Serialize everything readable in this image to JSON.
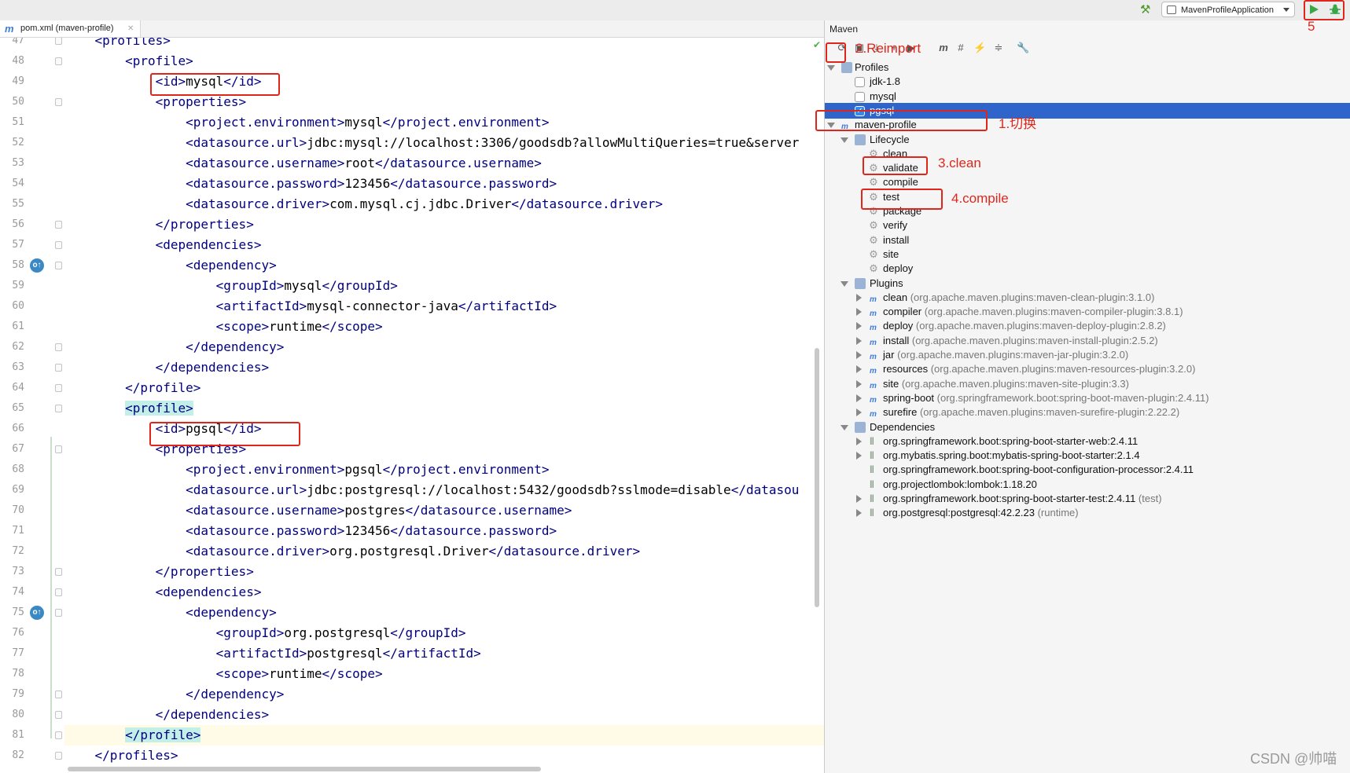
{
  "topbar": {
    "run_config": "MavenProfileApplication"
  },
  "editor": {
    "tab_label": "pom.xml (maven-profile)",
    "lines": [
      {
        "n": "47",
        "indent": "    ",
        "parts": [
          [
            "tg",
            "<profiles>"
          ]
        ]
      },
      {
        "n": "48",
        "indent": "        ",
        "parts": [
          [
            "tg",
            "<profile>"
          ]
        ]
      },
      {
        "n": "49",
        "indent": "            ",
        "parts": [
          [
            "tg",
            "<id>"
          ],
          [
            "tx",
            "mysql"
          ],
          [
            "tg",
            "</id>"
          ]
        ]
      },
      {
        "n": "50",
        "indent": "            ",
        "parts": [
          [
            "tg",
            "<properties>"
          ]
        ]
      },
      {
        "n": "51",
        "indent": "                ",
        "parts": [
          [
            "tg",
            "<project.environment>"
          ],
          [
            "tx",
            "mysql"
          ],
          [
            "tg",
            "</project.environment>"
          ]
        ]
      },
      {
        "n": "52",
        "indent": "                ",
        "parts": [
          [
            "tg",
            "<datasource.url>"
          ],
          [
            "tx",
            "jdbc:mysql://localhost:3306/goodsdb?allowMultiQueries=true&server"
          ]
        ]
      },
      {
        "n": "53",
        "indent": "                ",
        "parts": [
          [
            "tg",
            "<datasource.username>"
          ],
          [
            "tx",
            "root"
          ],
          [
            "tg",
            "</datasource.username>"
          ]
        ]
      },
      {
        "n": "54",
        "indent": "                ",
        "parts": [
          [
            "tg",
            "<datasource.password>"
          ],
          [
            "tx",
            "123456"
          ],
          [
            "tg",
            "</datasource.password>"
          ]
        ]
      },
      {
        "n": "55",
        "indent": "                ",
        "parts": [
          [
            "tg",
            "<datasource.driver>"
          ],
          [
            "tx",
            "com.mysql.cj.jdbc.Driver"
          ],
          [
            "tg",
            "</datasource.driver>"
          ]
        ]
      },
      {
        "n": "56",
        "indent": "            ",
        "parts": [
          [
            "tg",
            "</properties>"
          ]
        ]
      },
      {
        "n": "57",
        "indent": "            ",
        "parts": [
          [
            "tg",
            "<dependencies>"
          ]
        ]
      },
      {
        "n": "58",
        "indent": "                ",
        "parts": [
          [
            "tg",
            "<dependency>"
          ]
        ]
      },
      {
        "n": "59",
        "indent": "                    ",
        "parts": [
          [
            "tg",
            "<groupId>"
          ],
          [
            "tx",
            "mysql"
          ],
          [
            "tg",
            "</groupId>"
          ]
        ]
      },
      {
        "n": "60",
        "indent": "                    ",
        "parts": [
          [
            "tg",
            "<artifactId>"
          ],
          [
            "tx",
            "mysql-connector-java"
          ],
          [
            "tg",
            "</artifactId>"
          ]
        ]
      },
      {
        "n": "61",
        "indent": "                    ",
        "parts": [
          [
            "tg",
            "<scope>"
          ],
          [
            "tx",
            "runtime"
          ],
          [
            "tg",
            "</scope>"
          ]
        ]
      },
      {
        "n": "62",
        "indent": "                ",
        "parts": [
          [
            "tg",
            "</dependency>"
          ]
        ]
      },
      {
        "n": "63",
        "indent": "            ",
        "parts": [
          [
            "tg",
            "</dependencies>"
          ]
        ]
      },
      {
        "n": "64",
        "indent": "        ",
        "parts": [
          [
            "tg",
            "</profile>"
          ]
        ]
      },
      {
        "n": "65",
        "indent": "        ",
        "parts": [
          [
            "hl",
            "<profile>"
          ]
        ]
      },
      {
        "n": "66",
        "indent": "            ",
        "parts": [
          [
            "tg",
            "<id>"
          ],
          [
            "tx",
            "pgsql"
          ],
          [
            "tg",
            "</id>"
          ]
        ]
      },
      {
        "n": "67",
        "indent": "            ",
        "parts": [
          [
            "tg",
            "<properties>"
          ]
        ]
      },
      {
        "n": "68",
        "indent": "                ",
        "parts": [
          [
            "tg",
            "<project.environment>"
          ],
          [
            "tx",
            "pgsql"
          ],
          [
            "tg",
            "</project.environment>"
          ]
        ]
      },
      {
        "n": "69",
        "indent": "                ",
        "parts": [
          [
            "tg",
            "<datasource.url>"
          ],
          [
            "tx",
            "jdbc:postgresql://localhost:5432/goodsdb?sslmode=disable"
          ],
          [
            "tg",
            "</datasou"
          ]
        ]
      },
      {
        "n": "70",
        "indent": "                ",
        "parts": [
          [
            "tg",
            "<datasource.username>"
          ],
          [
            "tx",
            "postgres"
          ],
          [
            "tg",
            "</datasource.username>"
          ]
        ]
      },
      {
        "n": "71",
        "indent": "                ",
        "parts": [
          [
            "tg",
            "<datasource.password>"
          ],
          [
            "tx",
            "123456"
          ],
          [
            "tg",
            "</datasource.password>"
          ]
        ]
      },
      {
        "n": "72",
        "indent": "                ",
        "parts": [
          [
            "tg",
            "<datasource.driver>"
          ],
          [
            "tx",
            "org.postgresql.Driver"
          ],
          [
            "tg",
            "</datasource.driver>"
          ]
        ]
      },
      {
        "n": "73",
        "indent": "            ",
        "parts": [
          [
            "tg",
            "</properties>"
          ]
        ]
      },
      {
        "n": "74",
        "indent": "            ",
        "parts": [
          [
            "tg",
            "<dependencies>"
          ]
        ]
      },
      {
        "n": "75",
        "indent": "                ",
        "parts": [
          [
            "tg",
            "<dependency>"
          ]
        ]
      },
      {
        "n": "76",
        "indent": "                    ",
        "parts": [
          [
            "tg",
            "<groupId>"
          ],
          [
            "tx",
            "org.postgresql"
          ],
          [
            "tg",
            "</groupId>"
          ]
        ]
      },
      {
        "n": "77",
        "indent": "                    ",
        "parts": [
          [
            "tg",
            "<artifactId>"
          ],
          [
            "tx",
            "postgresql"
          ],
          [
            "tg",
            "</artifactId>"
          ]
        ]
      },
      {
        "n": "78",
        "indent": "                    ",
        "parts": [
          [
            "tg",
            "<scope>"
          ],
          [
            "tx",
            "runtime"
          ],
          [
            "tg",
            "</scope>"
          ]
        ]
      },
      {
        "n": "79",
        "indent": "                ",
        "parts": [
          [
            "tg",
            "</dependency>"
          ]
        ]
      },
      {
        "n": "80",
        "indent": "            ",
        "parts": [
          [
            "tg",
            "</dependencies>"
          ]
        ]
      },
      {
        "n": "81",
        "indent": "        ",
        "parts": [
          [
            "hl",
            "</profile>"
          ]
        ]
      },
      {
        "n": "82",
        "indent": "    ",
        "parts": [
          [
            "tg",
            "</profiles>"
          ]
        ]
      }
    ]
  },
  "maven": {
    "title": "Maven",
    "profiles_label": "Profiles",
    "profiles": [
      {
        "name": "jdk-1.8",
        "checked": false
      },
      {
        "name": "mysql",
        "checked": false
      },
      {
        "name": "pgsql",
        "checked": true
      }
    ],
    "project_label": "maven-profile",
    "lifecycle_label": "Lifecycle",
    "lifecycle": [
      "clean",
      "validate",
      "compile",
      "test",
      "package",
      "verify",
      "install",
      "site",
      "deploy"
    ],
    "plugins_label": "Plugins",
    "plugins": [
      {
        "name": "clean",
        "coord": "(org.apache.maven.plugins:maven-clean-plugin:3.1.0)"
      },
      {
        "name": "compiler",
        "coord": "(org.apache.maven.plugins:maven-compiler-plugin:3.8.1)"
      },
      {
        "name": "deploy",
        "coord": "(org.apache.maven.plugins:maven-deploy-plugin:2.8.2)"
      },
      {
        "name": "install",
        "coord": "(org.apache.maven.plugins:maven-install-plugin:2.5.2)"
      },
      {
        "name": "jar",
        "coord": "(org.apache.maven.plugins:maven-jar-plugin:3.2.0)"
      },
      {
        "name": "resources",
        "coord": "(org.apache.maven.plugins:maven-resources-plugin:3.2.0)"
      },
      {
        "name": "site",
        "coord": "(org.apache.maven.plugins:maven-site-plugin:3.3)"
      },
      {
        "name": "spring-boot",
        "coord": "(org.springframework.boot:spring-boot-maven-plugin:2.4.11)"
      },
      {
        "name": "surefire",
        "coord": "(org.apache.maven.plugins:maven-surefire-plugin:2.22.2)"
      }
    ],
    "dependencies_label": "Dependencies",
    "dependencies": [
      {
        "name": "org.springframework.boot:spring-boot-starter-web:2.4.11",
        "note": "",
        "expandable": true
      },
      {
        "name": "org.mybatis.spring.boot:mybatis-spring-boot-starter:2.1.4",
        "note": "",
        "expandable": true
      },
      {
        "name": "org.springframework.boot:spring-boot-configuration-processor:2.4.11",
        "note": "",
        "expandable": false
      },
      {
        "name": "org.projectlombok:lombok:1.18.20",
        "note": "",
        "expandable": false
      },
      {
        "name": "org.springframework.boot:spring-boot-starter-test:2.4.11",
        "note": "(test)",
        "expandable": true
      },
      {
        "name": "org.postgresql:postgresql:42.2.23",
        "note": "(runtime)",
        "expandable": true
      }
    ]
  },
  "annotations": {
    "step1": "1.切换",
    "step2": "2.Reimport",
    "step3": "3.clean",
    "step4": "4.compile",
    "step5": "5",
    "color": "#e0261b"
  },
  "watermark": "CSDN @帅喵"
}
